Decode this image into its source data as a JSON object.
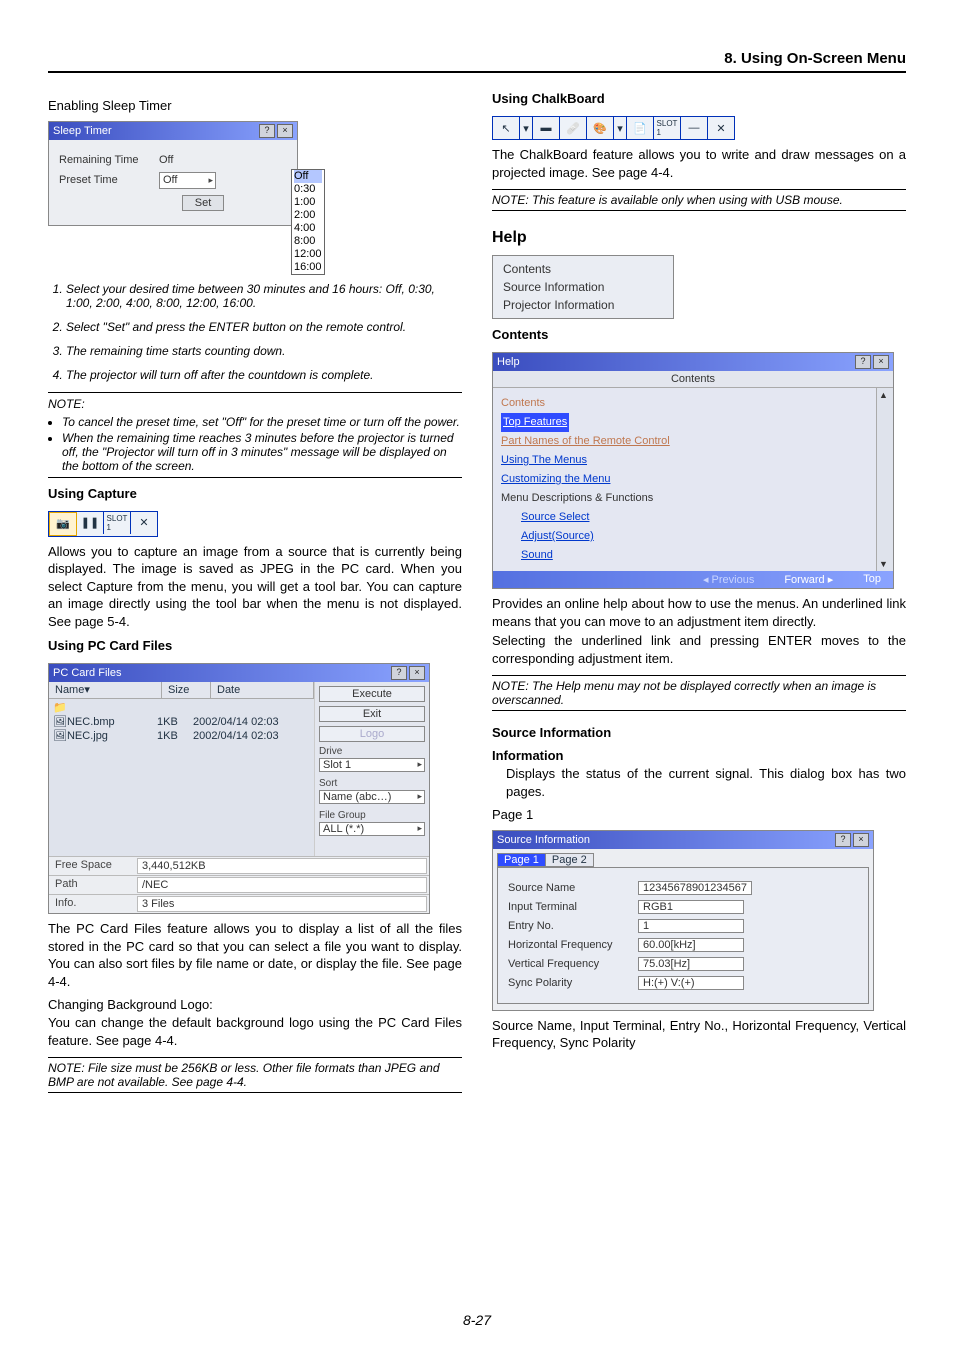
{
  "header": "8. Using On-Screen Menu",
  "left": {
    "enablingSleep": "Enabling Sleep Timer",
    "sleepTimer": {
      "title": "Sleep Timer",
      "remainingLabel": "Remaining Time",
      "remainingValue": "Off",
      "presetLabel": "Preset Time",
      "presetValue": "Off",
      "setBtn": "Set",
      "options": [
        "Off",
        "0:30",
        "1:00",
        "2:00",
        "4:00",
        "8:00",
        "12:00",
        "16:00"
      ]
    },
    "steps": [
      "Select your desired time between 30 minutes and 16 hours: Off, 0:30, 1:00, 2:00, 4:00, 8:00, 12:00, 16:00.",
      "Select \"Set\" and press the ENTER button on the remote control.",
      "The remaining time starts counting down.",
      "The projector will turn off after the countdown is complete."
    ],
    "noteLabel": "NOTE:",
    "noteBullets": [
      "To cancel the preset time, set \"Off\" for the preset time or turn off the power.",
      "When the remaining time reaches 3 minutes before the projector is turned off, the \"Projector will turn off in 3 minutes\" message will be displayed on the bottom of the screen."
    ],
    "usingCapture": "Using Capture",
    "captureIcons": [
      "camera-icon",
      "pause-icon",
      "slot-icon",
      "close-icon"
    ],
    "captureText": "Allows you to capture an image from a source that is currently being displayed. The image is saved as JPEG in the PC card. When you select Capture from the menu, you will get a tool bar. You can capture an image directly using the tool bar when the menu is not displayed. See page 5-4.",
    "usingPCCard": "Using PC Card Files",
    "pcFiles": {
      "title": "PC Card Files",
      "cols": {
        "name": "Name▾",
        "size": "Size",
        "date": "Date"
      },
      "rows": [
        {
          "name": "NEC.bmp",
          "size": "1KB",
          "date": "2002/04/14 02:03"
        },
        {
          "name": "NEC.jpg",
          "size": "1KB",
          "date": "2002/04/14 02:03"
        }
      ],
      "execute": "Execute",
      "exit": "Exit",
      "logo": "Logo",
      "driveLbl": "Drive",
      "driveVal": "Slot 1",
      "sortLbl": "Sort",
      "sortVal": "Name (abc…)",
      "fgroupLbl": "File Group",
      "fgroupVal": "ALL (*.*)",
      "freeSpaceLbl": "Free Space",
      "freeSpaceVal": "3,440,512KB",
      "pathLbl": "Path",
      "pathVal": "/NEC",
      "infoLbl": "Info.",
      "infoVal": "3 Files"
    },
    "pcFilesText": "The PC Card Files feature allows you to display a list of all the files stored in the PC card so that you can select a file you want to display. You can also sort files by file name or date, or display the file. See page 4-4.",
    "changingLogoHdr": "Changing Background Logo:",
    "changingLogoText": "You can change the default background logo using the PC Card Files feature. See page 4-4.",
    "pcFilesNote": "NOTE: File size must be 256KB or less. Other file formats than JPEG and BMP are not available. See page 4-4."
  },
  "right": {
    "usingChalk": "Using ChalkBoard",
    "chalkIcons": [
      "pointer-icon",
      "dropdown-icon",
      "rect-icon",
      "eraser-icon",
      "palette-icon",
      "dropdown2-icon",
      "sheet-icon",
      "slot-icon",
      "minimize-icon",
      "close-icon"
    ],
    "chalkText": "The ChalkBoard feature allows you to write and draw messages on a projected image. See page 4-4.",
    "chalkNote": "NOTE: This feature is available only when using with USB mouse.",
    "helpHeading": "Help",
    "helpMenu": [
      "Contents",
      "Source Information",
      "Projector Information"
    ],
    "contentsHdr": "Contents",
    "helpWin": {
      "title": "Help",
      "tab": "Contents",
      "items": [
        {
          "text": "Contents",
          "type": "plain",
          "color": "#c07850"
        },
        {
          "text": "Top Features",
          "type": "sel"
        },
        {
          "text": "Part Names of the Remote Control",
          "type": "lnk",
          "color": "#c07850"
        },
        {
          "text": "Using The Menus",
          "type": "lnk"
        },
        {
          "text": "Customizing the Menu",
          "type": "lnk"
        },
        {
          "text": "Menu Descriptions & Functions",
          "type": "plain"
        },
        {
          "text": "Source Select",
          "type": "sub"
        },
        {
          "text": "Adjust(Source)",
          "type": "sub"
        },
        {
          "text": "Sound",
          "type": "sub"
        }
      ],
      "nav": {
        "prev": "◂ Previous",
        "fwd": "Forward ▸",
        "top": "Top"
      }
    },
    "contentsText": "Provides an online help about how to use the menus. An underlined link means that you can move to an adjustment item directly.",
    "contentsText2": "Selecting the underlined link and pressing ENTER moves to the corresponding adjustment item.",
    "contentsNote": "NOTE: The Help menu may not be displayed correctly when an image is overscanned.",
    "sourceInfoHdr": "Source Information",
    "infoHdr": "Information",
    "infoText": "Displays the status of the current signal. This dialog box has two pages.",
    "page1Lbl": "Page 1",
    "srcWin": {
      "title": "Source Information",
      "tabs": [
        "Page 1",
        "Page 2"
      ],
      "rows": [
        {
          "lbl": "Source Name",
          "val": "12345678901234567"
        },
        {
          "lbl": "Input Terminal",
          "val": "RGB1"
        },
        {
          "lbl": "Entry No.",
          "val": "1"
        },
        {
          "lbl": "Horizontal Frequency",
          "val": "60.00[kHz]"
        },
        {
          "lbl": "Vertical Frequency",
          "val": "75.03[Hz]"
        },
        {
          "lbl": "Sync Polarity",
          "val": "H:(+) V:(+)"
        }
      ]
    },
    "srcFooter": "Source Name, Input Terminal, Entry No., Horizontal Frequency, Vertical Frequency, Sync Polarity"
  },
  "pageNum": "8-27"
}
